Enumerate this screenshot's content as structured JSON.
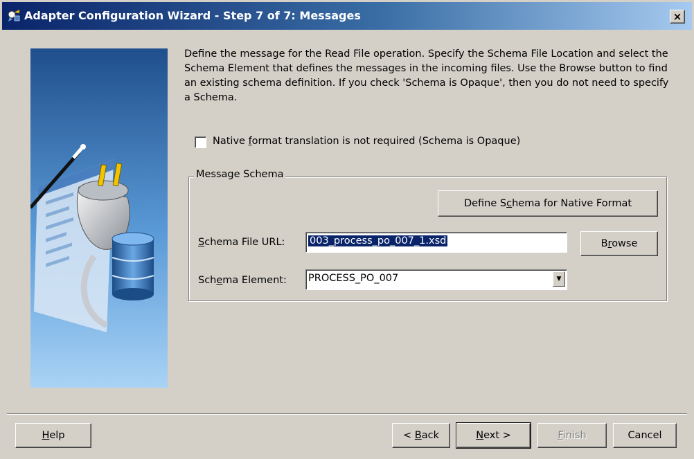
{
  "window": {
    "title": "Adapter Configuration Wizard - Step 7 of 7: Messages",
    "close_label": "×"
  },
  "description": "Define the message for the Read File operation.  Specify the Schema File Location and select the Schema Element that defines the messages in the incoming files. Use the Browse button to find an existing schema definition. If you check 'Schema is Opaque', then you do not need to specify a Schema.",
  "opaque": {
    "checked": false,
    "label_pre": "Native ",
    "label_mnemonic": "f",
    "label_post": "ormat translation is not required (Schema is Opaque)"
  },
  "message_schema": {
    "legend": "Message Schema",
    "define_button": {
      "pre": "Define S",
      "mnemonic": "c",
      "post": "hema for Native Format"
    },
    "schema_file_url": {
      "label_mnemonic": "S",
      "label_post": "chema File URL:",
      "value": "003_process_po_007_1.xsd"
    },
    "browse_button": {
      "pre": "B",
      "mnemonic": "r",
      "post": "owse"
    },
    "schema_element": {
      "label_pre": "Sch",
      "label_mnemonic": "e",
      "label_post": "ma Element:",
      "value": "PROCESS_PO_007"
    }
  },
  "footer": {
    "help": {
      "mnemonic": "H",
      "post": "elp"
    },
    "back": {
      "pre": "< ",
      "mnemonic": "B",
      "post": "ack"
    },
    "next": {
      "mnemonic": "N",
      "post": "ext >"
    },
    "finish": {
      "mnemonic": "F",
      "post": "inish",
      "enabled": false
    },
    "cancel": "Cancel"
  },
  "colors": {
    "titlebar_start": "#0a246a",
    "titlebar_end": "#a6caf0",
    "dialog_bg": "#d4d0c8",
    "selection": "#0a246a",
    "side_panel_top": "#1f4f8c",
    "side_panel_bottom": "#9dc8f0"
  },
  "icons": {
    "title": "wizard-icon",
    "side": "plug-database-illustration"
  }
}
